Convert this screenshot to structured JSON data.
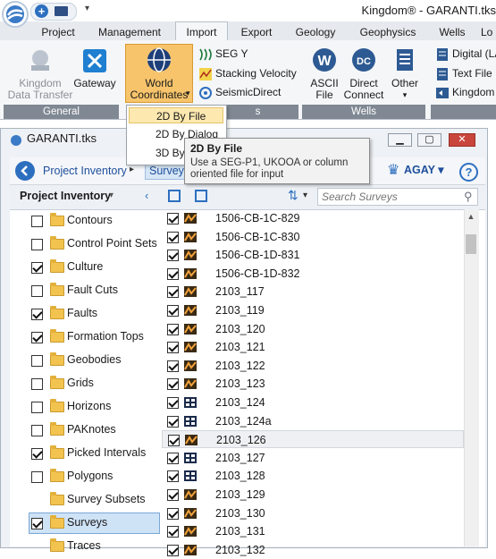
{
  "app": {
    "window_title": "Kingdom® - GARANTI.tks"
  },
  "qat": {
    "new_icon": "plus-circle-icon",
    "open_icon": "folder-open-icon",
    "customize_icon": "chevron-down-icon"
  },
  "ribbon_tabs": [
    {
      "label": "Project",
      "active": false
    },
    {
      "label": "Management",
      "active": false
    },
    {
      "label": "Import",
      "active": true
    },
    {
      "label": "Export",
      "active": false
    },
    {
      "label": "Geology",
      "active": false
    },
    {
      "label": "Geophysics",
      "active": false
    },
    {
      "label": "Wells",
      "active": false
    },
    {
      "label": "Lo",
      "active": false
    }
  ],
  "ribbon": {
    "general": {
      "label": "General",
      "kingdom_data_transfer_line1": "Kingdom",
      "kingdom_data_transfer_line2": "Data Transfer",
      "gateway": "Gateway"
    },
    "world_coordinates_line1": "World",
    "world_coordinates_line2": "Coordinates",
    "group_tail_label": "s",
    "seg_y": "SEG Y",
    "stacking_velocity": "Stacking Velocity",
    "seismic_direct": "SeismicDirect",
    "wells": {
      "label": "Wells",
      "ascii_file_line1": "ASCII",
      "ascii_file_line2": "File",
      "direct_connect_line1": "Direct",
      "direct_connect_line2": "Connect",
      "other": "Other"
    },
    "right_group": {
      "digital_las": "Digital (LA",
      "text_file": "Text File",
      "kingdom": "Kingdom"
    }
  },
  "dropdown": {
    "items": [
      "2D By File",
      "2D By Dialog",
      "3D By"
    ]
  },
  "tooltip": {
    "title": "2D By File",
    "body_line1": "Use a SEG-P1, UKOOA or column",
    "body_line2": "oriented file for input"
  },
  "document": {
    "title": "GARANTI.tks",
    "breadcrumb": [
      "Project Inventory",
      "Surveys"
    ],
    "user": "AGAY",
    "help": "?"
  },
  "left_panel": {
    "header": "Project Inventory",
    "items": [
      {
        "label": "Contours",
        "checked": false,
        "has_checkbox": true
      },
      {
        "label": "Control Point Sets",
        "checked": false,
        "has_checkbox": true
      },
      {
        "label": "Culture",
        "checked": true,
        "has_checkbox": true
      },
      {
        "label": "Fault Cuts",
        "checked": false,
        "has_checkbox": true
      },
      {
        "label": "Faults",
        "checked": true,
        "has_checkbox": true
      },
      {
        "label": "Formation Tops",
        "checked": true,
        "has_checkbox": true
      },
      {
        "label": "Geobodies",
        "checked": false,
        "has_checkbox": true
      },
      {
        "label": "Grids",
        "checked": false,
        "has_checkbox": true
      },
      {
        "label": "Horizons",
        "checked": false,
        "has_checkbox": true
      },
      {
        "label": "PAKnotes",
        "checked": false,
        "has_checkbox": true
      },
      {
        "label": "Picked Intervals",
        "checked": true,
        "has_checkbox": true
      },
      {
        "label": "Polygons",
        "checked": false,
        "has_checkbox": true
      },
      {
        "label": "Survey Subsets",
        "checked": false,
        "has_checkbox": false
      },
      {
        "label": "Surveys",
        "checked": true,
        "has_checkbox": true,
        "selected": true
      },
      {
        "label": "Traces",
        "checked": false,
        "has_checkbox": false
      }
    ]
  },
  "surveys": {
    "search_placeholder": "Search Surveys",
    "items": [
      {
        "label": "1506-CB-1C-829",
        "checked": true,
        "icon": "survey-2d-icon"
      },
      {
        "label": "1506-CB-1C-830",
        "checked": true,
        "icon": "survey-2d-icon"
      },
      {
        "label": "1506-CB-1D-831",
        "checked": true,
        "icon": "survey-2d-icon"
      },
      {
        "label": "1506-CB-1D-832",
        "checked": true,
        "icon": "survey-2d-icon"
      },
      {
        "label": "2103_117",
        "checked": true,
        "icon": "survey-2d-icon"
      },
      {
        "label": "2103_119",
        "checked": true,
        "icon": "survey-2d-icon"
      },
      {
        "label": "2103_120",
        "checked": true,
        "icon": "survey-2d-icon"
      },
      {
        "label": "2103_121",
        "checked": true,
        "icon": "survey-2d-icon"
      },
      {
        "label": "2103_122",
        "checked": true,
        "icon": "survey-2d-icon"
      },
      {
        "label": "2103_123",
        "checked": true,
        "icon": "survey-2d-icon"
      },
      {
        "label": "2103_124",
        "checked": true,
        "icon": "survey-3d-icon"
      },
      {
        "label": "2103_124a",
        "checked": true,
        "icon": "survey-3d-icon"
      },
      {
        "label": "2103_126",
        "checked": true,
        "icon": "survey-2d-icon",
        "highlighted": true
      },
      {
        "label": "2103_127",
        "checked": true,
        "icon": "survey-3d-icon"
      },
      {
        "label": "2103_128",
        "checked": true,
        "icon": "survey-3d-icon"
      },
      {
        "label": "2103_129",
        "checked": true,
        "icon": "survey-2d-icon"
      },
      {
        "label": "2103_130",
        "checked": true,
        "icon": "survey-2d-icon"
      },
      {
        "label": "2103_131",
        "checked": true,
        "icon": "survey-2d-icon"
      },
      {
        "label": "2103_132",
        "checked": true,
        "icon": "survey-2d-icon"
      }
    ]
  },
  "colors": {
    "accent": "#2d6fbf",
    "ribbon_group": "#7f8893",
    "highlight": "#fde9b0",
    "selected": "#cfe3f7",
    "close": "#c9463d"
  }
}
